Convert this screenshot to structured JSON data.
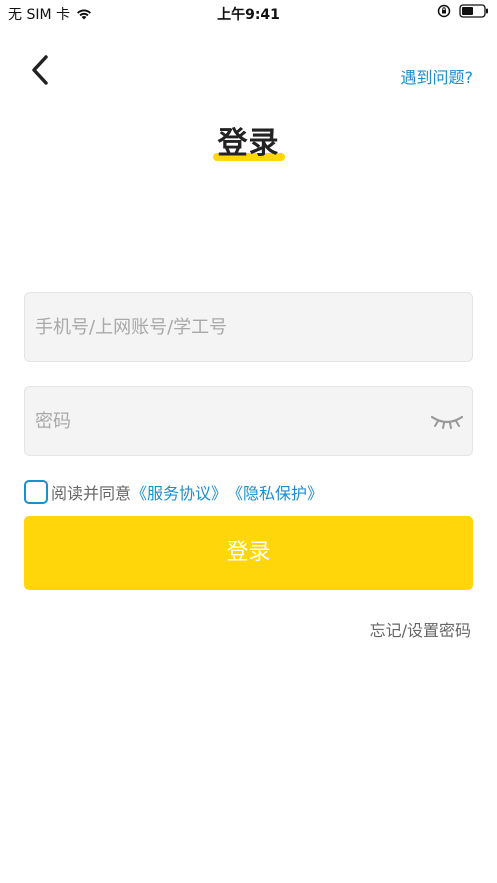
{
  "status_bar": {
    "carrier": "无 SIM 卡",
    "time": "上午9:41",
    "icons": [
      "wifi-icon",
      "rotation-lock-icon",
      "battery-icon"
    ]
  },
  "header": {
    "back_icon": "chevron-left-icon",
    "help_link": "遇到问题?",
    "title": "登录"
  },
  "form": {
    "account_placeholder": "手机号/上网账号/学工号",
    "account_value": "",
    "password_placeholder": "密码",
    "password_value": "",
    "password_toggle_icon": "eye-closed-icon"
  },
  "agreement": {
    "checked": false,
    "prefix": "阅读并同意",
    "service_link": "《服务协议》",
    "privacy_link": "《隐私保护》"
  },
  "login_button_label": "登录",
  "forgot_password_link": "忘记/设置密码",
  "colors": {
    "accent_yellow": "#ffd60a",
    "link_blue": "#1a8fd0",
    "field_bg": "#f4f4f4",
    "muted_text": "#666666"
  }
}
